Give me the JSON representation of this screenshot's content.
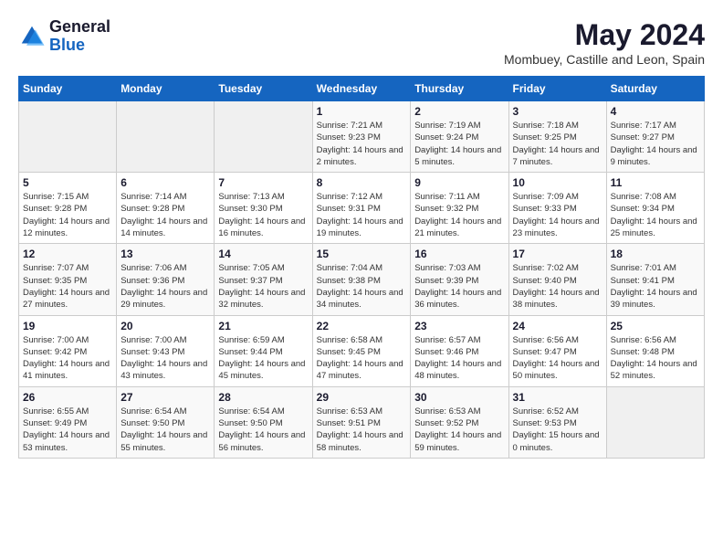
{
  "logo": {
    "text_general": "General",
    "text_blue": "Blue"
  },
  "header": {
    "month_year": "May 2024",
    "location": "Mombuey, Castille and Leon, Spain"
  },
  "days_of_week": [
    "Sunday",
    "Monday",
    "Tuesday",
    "Wednesday",
    "Thursday",
    "Friday",
    "Saturday"
  ],
  "weeks": [
    [
      {
        "day": "",
        "sunrise": "",
        "sunset": "",
        "daylight": "",
        "empty": true
      },
      {
        "day": "",
        "sunrise": "",
        "sunset": "",
        "daylight": "",
        "empty": true
      },
      {
        "day": "",
        "sunrise": "",
        "sunset": "",
        "daylight": "",
        "empty": true
      },
      {
        "day": "1",
        "sunrise": "Sunrise: 7:21 AM",
        "sunset": "Sunset: 9:23 PM",
        "daylight": "Daylight: 14 hours and 2 minutes."
      },
      {
        "day": "2",
        "sunrise": "Sunrise: 7:19 AM",
        "sunset": "Sunset: 9:24 PM",
        "daylight": "Daylight: 14 hours and 5 minutes."
      },
      {
        "day": "3",
        "sunrise": "Sunrise: 7:18 AM",
        "sunset": "Sunset: 9:25 PM",
        "daylight": "Daylight: 14 hours and 7 minutes."
      },
      {
        "day": "4",
        "sunrise": "Sunrise: 7:17 AM",
        "sunset": "Sunset: 9:27 PM",
        "daylight": "Daylight: 14 hours and 9 minutes."
      }
    ],
    [
      {
        "day": "5",
        "sunrise": "Sunrise: 7:15 AM",
        "sunset": "Sunset: 9:28 PM",
        "daylight": "Daylight: 14 hours and 12 minutes."
      },
      {
        "day": "6",
        "sunrise": "Sunrise: 7:14 AM",
        "sunset": "Sunset: 9:28 PM",
        "daylight": "Daylight: 14 hours and 14 minutes."
      },
      {
        "day": "7",
        "sunrise": "Sunrise: 7:13 AM",
        "sunset": "Sunset: 9:30 PM",
        "daylight": "Daylight: 14 hours and 16 minutes."
      },
      {
        "day": "8",
        "sunrise": "Sunrise: 7:12 AM",
        "sunset": "Sunset: 9:31 PM",
        "daylight": "Daylight: 14 hours and 19 minutes."
      },
      {
        "day": "9",
        "sunrise": "Sunrise: 7:11 AM",
        "sunset": "Sunset: 9:32 PM",
        "daylight": "Daylight: 14 hours and 21 minutes."
      },
      {
        "day": "10",
        "sunrise": "Sunrise: 7:09 AM",
        "sunset": "Sunset: 9:33 PM",
        "daylight": "Daylight: 14 hours and 23 minutes."
      },
      {
        "day": "11",
        "sunrise": "Sunrise: 7:08 AM",
        "sunset": "Sunset: 9:34 PM",
        "daylight": "Daylight: 14 hours and 25 minutes."
      }
    ],
    [
      {
        "day": "12",
        "sunrise": "Sunrise: 7:07 AM",
        "sunset": "Sunset: 9:35 PM",
        "daylight": "Daylight: 14 hours and 27 minutes."
      },
      {
        "day": "13",
        "sunrise": "Sunrise: 7:06 AM",
        "sunset": "Sunset: 9:36 PM",
        "daylight": "Daylight: 14 hours and 29 minutes."
      },
      {
        "day": "14",
        "sunrise": "Sunrise: 7:05 AM",
        "sunset": "Sunset: 9:37 PM",
        "daylight": "Daylight: 14 hours and 32 minutes."
      },
      {
        "day": "15",
        "sunrise": "Sunrise: 7:04 AM",
        "sunset": "Sunset: 9:38 PM",
        "daylight": "Daylight: 14 hours and 34 minutes."
      },
      {
        "day": "16",
        "sunrise": "Sunrise: 7:03 AM",
        "sunset": "Sunset: 9:39 PM",
        "daylight": "Daylight: 14 hours and 36 minutes."
      },
      {
        "day": "17",
        "sunrise": "Sunrise: 7:02 AM",
        "sunset": "Sunset: 9:40 PM",
        "daylight": "Daylight: 14 hours and 38 minutes."
      },
      {
        "day": "18",
        "sunrise": "Sunrise: 7:01 AM",
        "sunset": "Sunset: 9:41 PM",
        "daylight": "Daylight: 14 hours and 39 minutes."
      }
    ],
    [
      {
        "day": "19",
        "sunrise": "Sunrise: 7:00 AM",
        "sunset": "Sunset: 9:42 PM",
        "daylight": "Daylight: 14 hours and 41 minutes."
      },
      {
        "day": "20",
        "sunrise": "Sunrise: 7:00 AM",
        "sunset": "Sunset: 9:43 PM",
        "daylight": "Daylight: 14 hours and 43 minutes."
      },
      {
        "day": "21",
        "sunrise": "Sunrise: 6:59 AM",
        "sunset": "Sunset: 9:44 PM",
        "daylight": "Daylight: 14 hours and 45 minutes."
      },
      {
        "day": "22",
        "sunrise": "Sunrise: 6:58 AM",
        "sunset": "Sunset: 9:45 PM",
        "daylight": "Daylight: 14 hours and 47 minutes."
      },
      {
        "day": "23",
        "sunrise": "Sunrise: 6:57 AM",
        "sunset": "Sunset: 9:46 PM",
        "daylight": "Daylight: 14 hours and 48 minutes."
      },
      {
        "day": "24",
        "sunrise": "Sunrise: 6:56 AM",
        "sunset": "Sunset: 9:47 PM",
        "daylight": "Daylight: 14 hours and 50 minutes."
      },
      {
        "day": "25",
        "sunrise": "Sunrise: 6:56 AM",
        "sunset": "Sunset: 9:48 PM",
        "daylight": "Daylight: 14 hours and 52 minutes."
      }
    ],
    [
      {
        "day": "26",
        "sunrise": "Sunrise: 6:55 AM",
        "sunset": "Sunset: 9:49 PM",
        "daylight": "Daylight: 14 hours and 53 minutes."
      },
      {
        "day": "27",
        "sunrise": "Sunrise: 6:54 AM",
        "sunset": "Sunset: 9:50 PM",
        "daylight": "Daylight: 14 hours and 55 minutes."
      },
      {
        "day": "28",
        "sunrise": "Sunrise: 6:54 AM",
        "sunset": "Sunset: 9:50 PM",
        "daylight": "Daylight: 14 hours and 56 minutes."
      },
      {
        "day": "29",
        "sunrise": "Sunrise: 6:53 AM",
        "sunset": "Sunset: 9:51 PM",
        "daylight": "Daylight: 14 hours and 58 minutes."
      },
      {
        "day": "30",
        "sunrise": "Sunrise: 6:53 AM",
        "sunset": "Sunset: 9:52 PM",
        "daylight": "Daylight: 14 hours and 59 minutes."
      },
      {
        "day": "31",
        "sunrise": "Sunrise: 6:52 AM",
        "sunset": "Sunset: 9:53 PM",
        "daylight": "Daylight: 15 hours and 0 minutes."
      },
      {
        "day": "",
        "sunrise": "",
        "sunset": "",
        "daylight": "",
        "empty": true
      }
    ]
  ]
}
